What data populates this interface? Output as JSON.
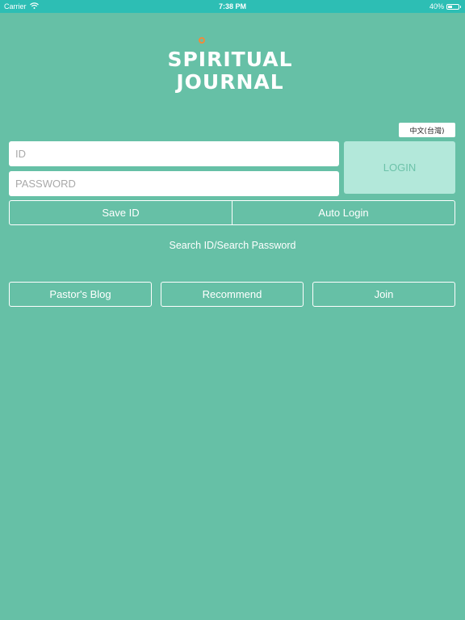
{
  "status_bar": {
    "carrier": "Carrier",
    "time": "7:38 PM",
    "battery": "40%",
    "battery_level": 0.4
  },
  "logo": {
    "line1": "SPIRITUAL",
    "line2": "JOURNAL"
  },
  "language_button": "中文(台灣)",
  "login_form": {
    "id_placeholder": "ID",
    "password_placeholder": "PASSWORD",
    "login_label": "LOGIN"
  },
  "options": {
    "save_id": "Save ID",
    "auto_login": "Auto Login"
  },
  "search_link": "Search ID/Search Password",
  "bottom_buttons": {
    "pastors_blog": "Pastor's Blog",
    "recommend": "Recommend",
    "join": "Join"
  },
  "colors": {
    "background": "#66c0a6",
    "status_bar": "#2dbeb4",
    "login_button": "#b3e8da",
    "logo_accent": "#f08a3c"
  }
}
